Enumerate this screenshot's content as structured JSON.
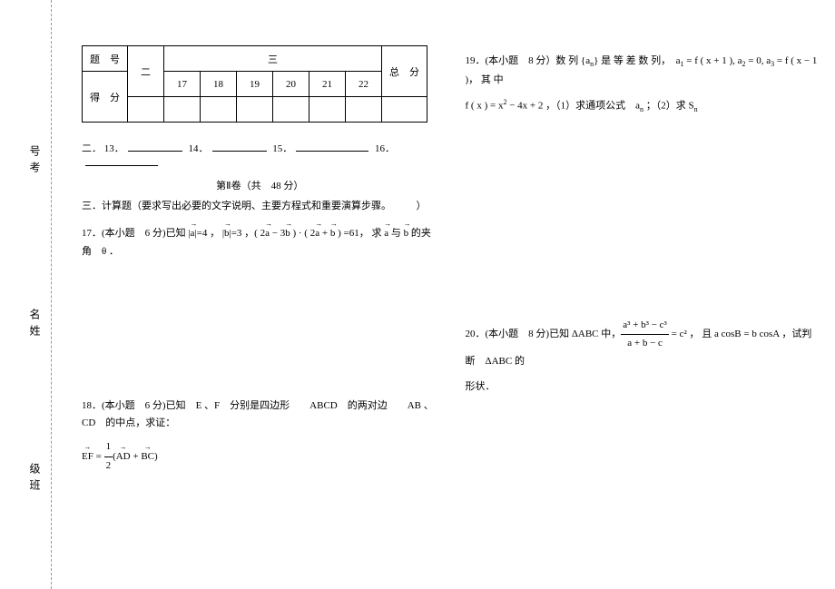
{
  "binding": {
    "label_exam_no": "号考",
    "label_name": "名姓",
    "label_class": "级班"
  },
  "score_table": {
    "row_label_no": "题　号",
    "row_label_score": "得　分",
    "col_two": "二",
    "col_three": "三",
    "total": "总　分",
    "nums": [
      "17",
      "18",
      "19",
      "20",
      "21",
      "22"
    ]
  },
  "section_two": {
    "prefix": "二．",
    "q13": "13．",
    "q14": "14．",
    "q15": "15．",
    "q16": "16．"
  },
  "paper_info": "第Ⅱ卷（共　48 分）",
  "section_three": "三．计算题（要求写出必要的文字说明、主要方程式和重要演算步骤。　　　）",
  "p17": {
    "head": "17．(本小题　6 分)已知 |",
    "a": "a",
    "mid1": "|=4 ， |",
    "b": "b",
    "mid2": "|=3 ，( 2",
    "mid3": " − 3",
    "mid4": " ) · ( 2",
    "mid5": " + ",
    "mid6": " ) =61， 求 ",
    "mid7": " 与 ",
    "tail": " 的夹角　θ ．"
  },
  "p18": {
    "line1_a": "18．(本小题　6 分)已知　E 、F　分别是四边形　　ABCD　的两对边　　AB 、CD　的中点，求证：",
    "ef": "EF",
    "eq": " = ",
    "half_num": "1",
    "half_den": "2",
    "lp": "(",
    "ad": "AD",
    "plus": " + ",
    "bc": "BC",
    "rp": ")"
  },
  "p19": {
    "a": "19．(本小题　8 分）数 列 {a",
    "a_sub": "n",
    "b": "} 是 等 差 数 列，　a",
    "b_sub": "1",
    "c": " = f ( x + 1 ), a",
    "c_sub": "2",
    "d": " = 0, a",
    "d_sub": "3",
    "e": " = f ( x − 1 )， 其 中",
    "line2_a": "f ( x ) = x",
    "line2_sup": "2",
    "line2_b": " − 4x + 2 ，（1）求通项公式　a",
    "line2_sub": "n",
    "line2_c": " ；（2）求 S",
    "line2_sub2": "n"
  },
  "p20": {
    "a": "20．(本小题　8 分)已知 ΔABC 中，",
    "frac_num": "a³ + b³ − c³",
    "frac_den": "a + b − c",
    "b": " = c² ， 且 a cosB = b cosA ，试判断　ΔABC 的",
    "line2": "形状．"
  }
}
